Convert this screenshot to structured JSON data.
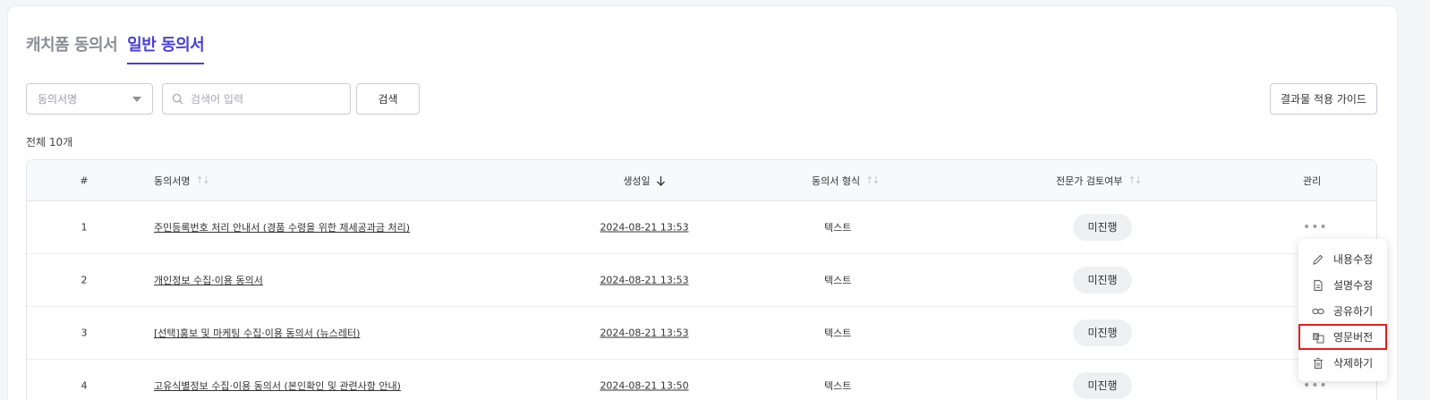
{
  "tabs": [
    {
      "label": "캐치폼 동의서",
      "active": false
    },
    {
      "label": "일반 동의서",
      "active": true
    }
  ],
  "filters": {
    "select_value": "동의서명",
    "search_placeholder": "검색어 입력",
    "search_button": "검색",
    "guide_button": "결과물 적용 가이드"
  },
  "total_label": "전체 10개",
  "table": {
    "headers": {
      "num": "#",
      "name": "동의서명",
      "date": "생성일",
      "type": "동의서 형식",
      "review": "전문가 검토여부",
      "mgmt": "관리"
    },
    "rows": [
      {
        "num": "1",
        "name": "주민등록번호 처리 안내서 (경품 수령을 위한 제세공과금 처리)",
        "date": "2024-08-21 13:53",
        "type": "텍스트",
        "review": "미진행"
      },
      {
        "num": "2",
        "name": "개인정보 수집·이용 동의서",
        "date": "2024-08-21 13:53",
        "type": "텍스트",
        "review": "미진행"
      },
      {
        "num": "3",
        "name": "[선택]홍보 및 마케팅 수집·이용 동의서 (뉴스레터)",
        "date": "2024-08-21 13:53",
        "type": "텍스트",
        "review": "미진행"
      },
      {
        "num": "4",
        "name": "고유식별정보 수집·이용 동의서 (본인확인 및 관련사항 안내)",
        "date": "2024-08-21 13:50",
        "type": "텍스트",
        "review": "미진행"
      }
    ]
  },
  "menu": {
    "items": [
      {
        "label": "내용수정",
        "icon": "pencil-icon"
      },
      {
        "label": "설명수정",
        "icon": "document-icon"
      },
      {
        "label": "공유하기",
        "icon": "link-icon"
      },
      {
        "label": "영문버전",
        "icon": "translate-icon",
        "highlighted": true
      },
      {
        "label": "삭제하기",
        "icon": "trash-icon"
      }
    ]
  },
  "colors": {
    "accent": "#4a3fd6",
    "highlight_border": "#e41e1e"
  }
}
